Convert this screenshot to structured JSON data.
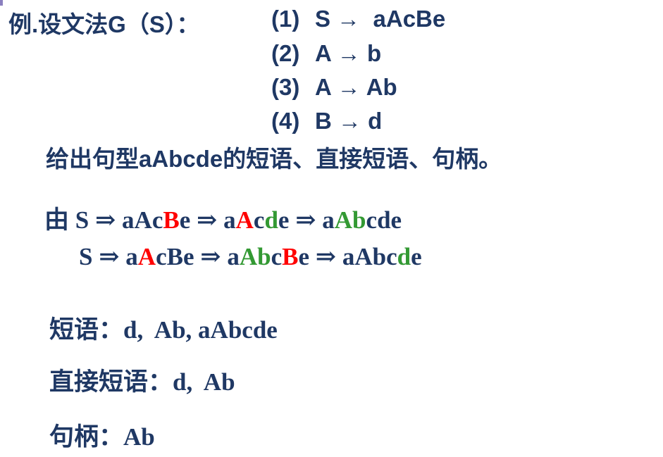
{
  "title": "例.设文法G（S）：",
  "rules": [
    {
      "num": "(1)",
      "text": "S →  aAcBe"
    },
    {
      "num": "(2)",
      "text": "A → b"
    },
    {
      "num": "(3)",
      "text": "A → Ab"
    },
    {
      "num": "(4)",
      "text": "B → d"
    }
  ],
  "question": "给出句型aAbcde的短语、直接短语、句柄。",
  "derivation_prefix": "由",
  "derivations": [
    [
      {
        "t": "S ⇒ aAc",
        "c": "#1f3864"
      },
      {
        "t": "B",
        "c": "#ff0000"
      },
      {
        "t": "e ⇒ a",
        "c": "#1f3864"
      },
      {
        "t": "A",
        "c": "#ff0000"
      },
      {
        "t": "c",
        "c": "#1f3864"
      },
      {
        "t": "d",
        "c": "#339933"
      },
      {
        "t": "e ⇒ a",
        "c": "#1f3864"
      },
      {
        "t": "Ab",
        "c": "#339933"
      },
      {
        "t": "cde",
        "c": "#1f3864"
      }
    ],
    [
      {
        "t": "S ⇒ a",
        "c": "#1f3864"
      },
      {
        "t": "A",
        "c": "#ff0000"
      },
      {
        "t": "cBe ⇒ a",
        "c": "#1f3864"
      },
      {
        "t": "Ab",
        "c": "#339933"
      },
      {
        "t": "c",
        "c": "#1f3864"
      },
      {
        "t": "B",
        "c": "#ff0000"
      },
      {
        "t": "e ⇒ aAbc",
        "c": "#1f3864"
      },
      {
        "t": "d",
        "c": "#339933"
      },
      {
        "t": "e",
        "c": "#1f3864"
      }
    ]
  ],
  "answers": [
    {
      "label": "短语：",
      "value": "d,  Ab, aAbcde"
    },
    {
      "label": "直接短语：",
      "value": "d,  Ab"
    },
    {
      "label": "句柄：",
      "value": "Ab"
    }
  ],
  "colors": {
    "text": "#1f3864",
    "red": "#ff0000",
    "green": "#339933"
  }
}
